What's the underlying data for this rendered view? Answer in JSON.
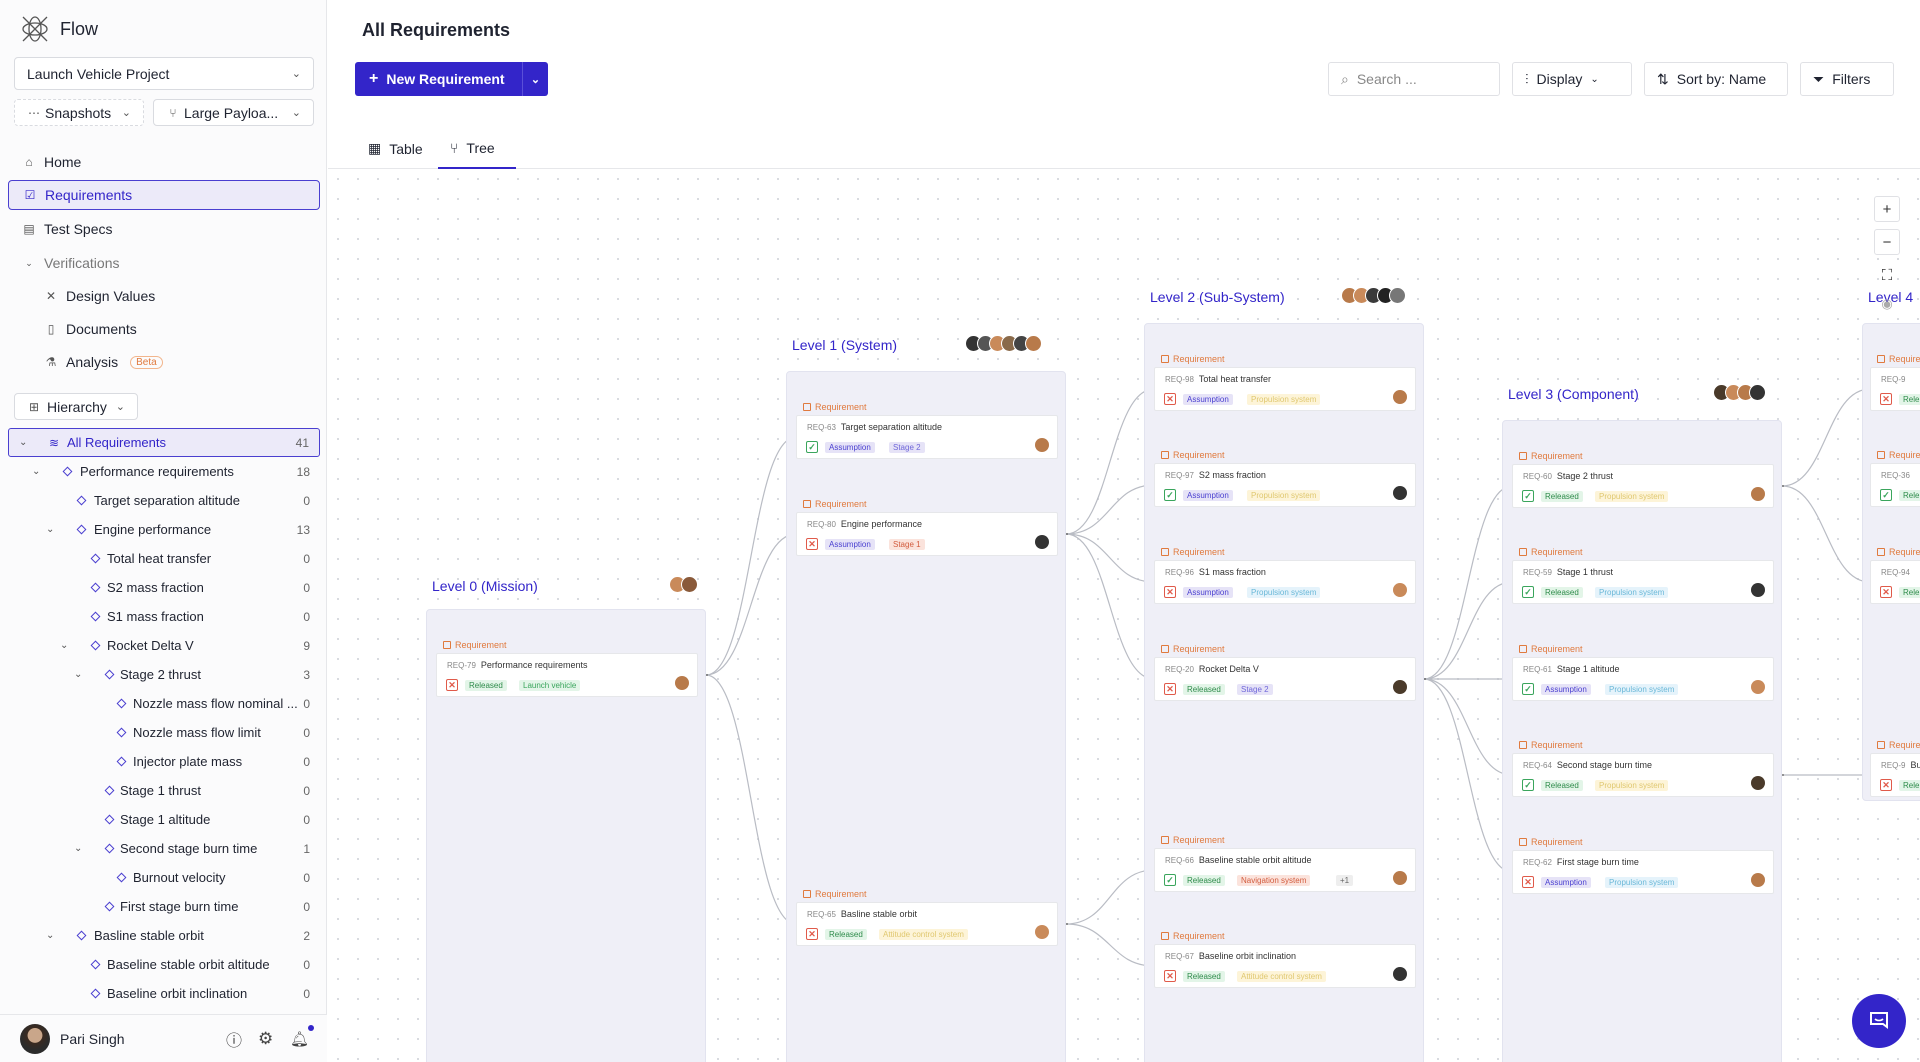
{
  "app": {
    "name": "Flow"
  },
  "project": {
    "name": "Launch Vehicle Project"
  },
  "snapshots": {
    "label": "Snapshots"
  },
  "branch": {
    "label": "Large Payloa..."
  },
  "nav": [
    {
      "label": "Home",
      "icon": "home-icon"
    },
    {
      "label": "Requirements",
      "icon": "checklist-icon"
    },
    {
      "label": "Test Specs",
      "icon": "clipboard-icon"
    },
    {
      "label": "Verifications",
      "icon": "chevron-down-icon"
    },
    {
      "label": "Design Values",
      "icon": "tools-icon"
    },
    {
      "label": "Documents",
      "icon": "document-icon"
    },
    {
      "label": "Analysis",
      "icon": "flask-icon",
      "badge": "Beta"
    }
  ],
  "hierarchy": {
    "label": "Hierarchy"
  },
  "tree": [
    {
      "label": "All Requirements",
      "count": "41"
    },
    {
      "label": "Performance requirements",
      "count": "18"
    },
    {
      "label": "Target separation altitude",
      "count": "0"
    },
    {
      "label": "Engine performance",
      "count": "13"
    },
    {
      "label": "Total heat transfer",
      "count": "0"
    },
    {
      "label": "S2 mass fraction",
      "count": "0"
    },
    {
      "label": "S1 mass fraction",
      "count": "0"
    },
    {
      "label": "Rocket Delta V",
      "count": "9"
    },
    {
      "label": "Stage 2 thrust",
      "count": "3"
    },
    {
      "label": "Nozzle mass flow nominal ...",
      "count": "0"
    },
    {
      "label": "Nozzle mass flow limit",
      "count": "0"
    },
    {
      "label": "Injector plate mass",
      "count": "0"
    },
    {
      "label": "Stage 1 thrust",
      "count": "0"
    },
    {
      "label": "Stage 1 altitude",
      "count": "0"
    },
    {
      "label": "Second stage burn time",
      "count": "1"
    },
    {
      "label": "Burnout velocity",
      "count": "0"
    },
    {
      "label": "First stage burn time",
      "count": "0"
    },
    {
      "label": "Basline stable orbit",
      "count": "2"
    },
    {
      "label": "Baseline stable orbit altitude",
      "count": "0"
    },
    {
      "label": "Baseline orbit inclination",
      "count": "0"
    }
  ],
  "user": {
    "name": "Pari Singh"
  },
  "page": {
    "title": "All Requirements"
  },
  "toolbar": {
    "new_label": "New Requirement",
    "search_placeholder": "Search ...",
    "display_label": "Display",
    "sort_label": "Sort by: Name",
    "filters_label": "Filters"
  },
  "tabs": [
    {
      "label": "Table"
    },
    {
      "label": "Tree"
    }
  ],
  "levels": [
    {
      "label": "Level 0 (Mission)"
    },
    {
      "label": "Level 1 (System)"
    },
    {
      "label": "Level 2 (Sub-System)"
    },
    {
      "label": "Level 3 (Component)"
    },
    {
      "label": "Level 4"
    }
  ],
  "card_kind": "Requirement",
  "cards": {
    "l0": [
      {
        "id": "REQ-79",
        "title": "Performance requirements",
        "status": "no",
        "tags": [
          [
            "Released",
            "t-rel"
          ],
          [
            "Launch vehicle",
            "t-lv"
          ]
        ]
      }
    ],
    "l1": [
      {
        "id": "REQ-63",
        "title": "Target separation altitude",
        "status": "ok",
        "tags": [
          [
            "Assumption",
            "t-ass"
          ],
          [
            "Stage 2",
            "t-st"
          ]
        ]
      },
      {
        "id": "REQ-80",
        "title": "Engine performance",
        "status": "no",
        "tags": [
          [
            "Assumption",
            "t-ass"
          ],
          [
            "Stage 1",
            "t-nav"
          ]
        ]
      },
      {
        "id": "REQ-65",
        "title": "Basline stable orbit",
        "status": "no",
        "tags": [
          [
            "Released",
            "t-rel"
          ],
          [
            "Attitude control system",
            "t-sys"
          ]
        ]
      }
    ],
    "l2": [
      {
        "id": "REQ-98",
        "title": "Total heat transfer",
        "status": "no",
        "tags": [
          [
            "Assumption",
            "t-ass"
          ],
          [
            "Propulsion system",
            "t-sys"
          ]
        ]
      },
      {
        "id": "REQ-97",
        "title": "S2 mass fraction",
        "status": "ok",
        "tags": [
          [
            "Assumption",
            "t-ass"
          ],
          [
            "Propulsion system",
            "t-sys"
          ]
        ]
      },
      {
        "id": "REQ-96",
        "title": "S1 mass fraction",
        "status": "no",
        "tags": [
          [
            "Assumption",
            "t-ass"
          ],
          [
            "Propulsion system",
            "t-prop"
          ]
        ]
      },
      {
        "id": "REQ-20",
        "title": "Rocket Delta V",
        "status": "no",
        "tags": [
          [
            "Released",
            "t-rel"
          ],
          [
            "Stage 2",
            "t-st"
          ]
        ]
      },
      {
        "id": "REQ-66",
        "title": "Baseline stable orbit altitude",
        "status": "ok",
        "tags": [
          [
            "Released",
            "t-rel"
          ],
          [
            "Navigation system",
            "t-nav"
          ],
          [
            "+1",
            "t-more"
          ]
        ]
      },
      {
        "id": "REQ-67",
        "title": "Baseline orbit inclination",
        "status": "no",
        "tags": [
          [
            "Released",
            "t-rel"
          ],
          [
            "Attitude control system",
            "t-sys"
          ]
        ]
      }
    ],
    "l3": [
      {
        "id": "REQ-60",
        "title": "Stage 2 thrust",
        "status": "ok",
        "tags": [
          [
            "Released",
            "t-rel"
          ],
          [
            "Propulsion system",
            "t-sys"
          ]
        ]
      },
      {
        "id": "REQ-59",
        "title": "Stage 1 thrust",
        "status": "ok",
        "tags": [
          [
            "Released",
            "t-rel"
          ],
          [
            "Propulsion system",
            "t-prop"
          ]
        ]
      },
      {
        "id": "REQ-61",
        "title": "Stage 1 altitude",
        "status": "ok",
        "tags": [
          [
            "Assumption",
            "t-ass"
          ],
          [
            "Propulsion system",
            "t-prop"
          ]
        ]
      },
      {
        "id": "REQ-64",
        "title": "Second stage burn time",
        "status": "ok",
        "tags": [
          [
            "Released",
            "t-rel"
          ],
          [
            "Propulsion system",
            "t-sys"
          ]
        ]
      },
      {
        "id": "REQ-62",
        "title": "First stage burn time",
        "status": "no",
        "tags": [
          [
            "Assumption",
            "t-ass"
          ],
          [
            "Propulsion system",
            "t-prop"
          ]
        ]
      }
    ],
    "l4": [
      {
        "id": "REQ-9",
        "title": "",
        "status": "no",
        "tags": [
          [
            "Rele",
            "t-rel"
          ]
        ]
      },
      {
        "id": "REQ-36",
        "title": "",
        "status": "ok",
        "tags": [
          [
            "Rele",
            "t-rel"
          ]
        ]
      },
      {
        "id": "REQ-94",
        "title": "",
        "status": "no",
        "tags": [
          [
            "Rele",
            "t-rel"
          ]
        ]
      },
      {
        "id": "REQ-9",
        "title": "Bu",
        "status": "no",
        "tags": [
          [
            "Rele",
            "t-rel"
          ]
        ]
      }
    ]
  }
}
